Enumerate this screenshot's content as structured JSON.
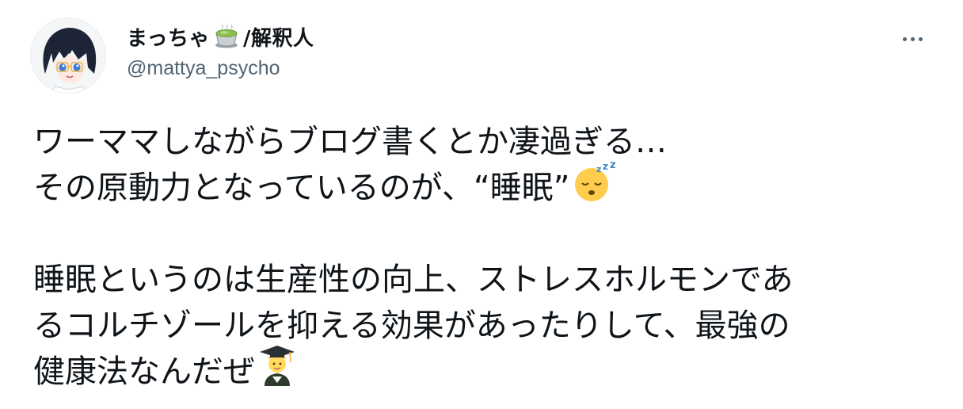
{
  "tweet": {
    "author": {
      "display_name": "まっちゃ",
      "name_suffix": "/解釈人",
      "handle": "@mattya_psycho",
      "name_emoji": "matcha-tea-emoji"
    },
    "text_lines": [
      "ワーママしながらブログ書くとか凄過ぎる…",
      "その原動力となっているのが、“睡眠”",
      "",
      "睡眠というのは生産性の向上、ストレスホルモンであ",
      "るコルチゾールを抑える効果があったりして、最強の",
      "健康法なんだぜ"
    ],
    "emojis": {
      "line2": "sleeping-face-emoji",
      "line6": "graduate-emoji"
    },
    "more_icon": "more-options-icon"
  },
  "colors": {
    "text_primary": "#0f1419",
    "text_secondary": "#536471",
    "background": "#ffffff"
  }
}
